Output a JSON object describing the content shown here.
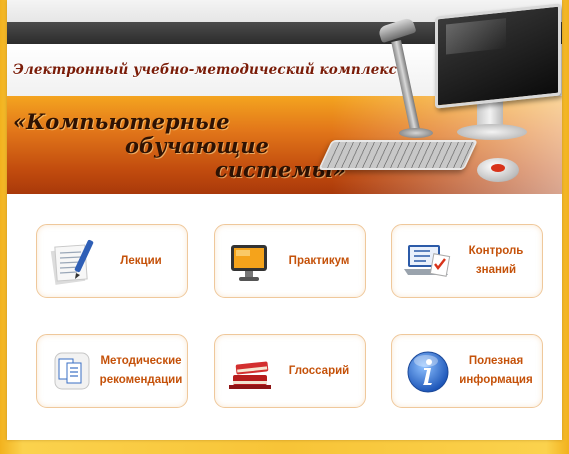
{
  "header": {
    "subtitle": "Электронный учебно-методический комплекс",
    "title_line1": "«Компьютерные",
    "title_line2": "обучающие",
    "title_line3": "системы»"
  },
  "menu": [
    {
      "label": "Лекции",
      "icon": "notebook-pen-icon"
    },
    {
      "label": "Практикум",
      "icon": "monitor-icon"
    },
    {
      "label": "Контроль\nзнаний",
      "icon": "laptop-checklist-icon"
    },
    {
      "label": "Методические\nрекомендации",
      "icon": "documents-icon"
    },
    {
      "label": "Глоссарий",
      "icon": "books-icon"
    },
    {
      "label": "Полезная\nинформация",
      "icon": "info-icon"
    }
  ],
  "colors": {
    "accent_orange": "#c5520a",
    "tile_border": "#efc89b",
    "page_frame": "#f7c437",
    "title_text": "#2e1203",
    "subtitle_text": "#7a1c08"
  }
}
